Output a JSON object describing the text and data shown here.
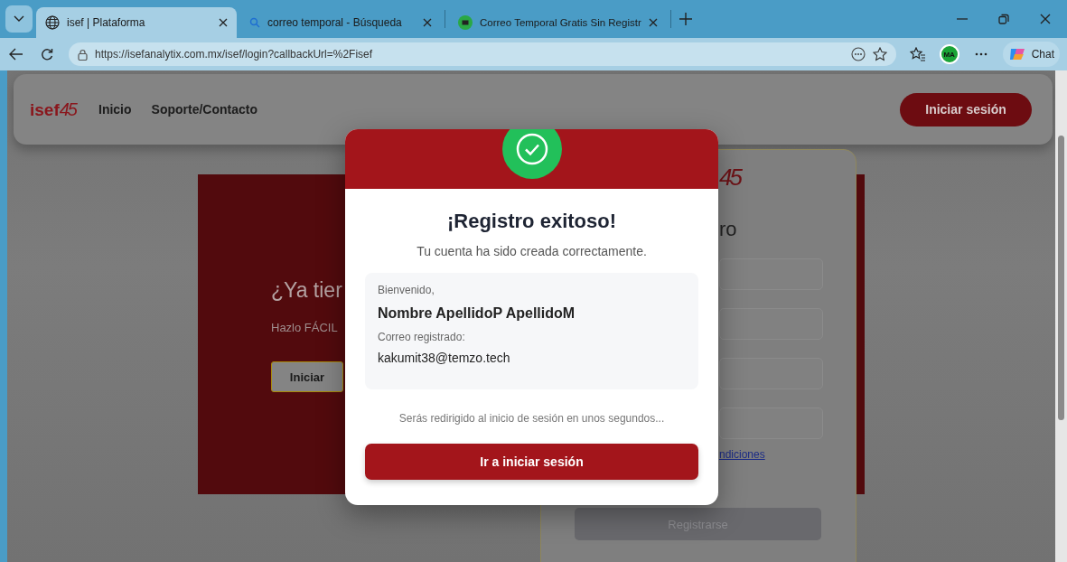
{
  "browser": {
    "tabs": [
      {
        "title": "isef | Plataforma",
        "selected": true
      },
      {
        "title": "correo temporal - Búsqueda",
        "selected": false
      },
      {
        "title": "Correo Temporal Gratis Sin Registr",
        "selected": false
      }
    ],
    "address": "https://isefanalytix.com.mx/isef/login?callbackUrl=%2Fisef",
    "profile": "MA",
    "chat": "Chat"
  },
  "header": {
    "logo": "isef",
    "logo_mark": "45",
    "nav": [
      "Inicio",
      "Soporte/Contacto"
    ],
    "login_button": "Iniciar sesión"
  },
  "left_panel": {
    "heading": "¿Ya tier",
    "text": "Hazlo FÁCIL",
    "button": "Iniciar"
  },
  "form": {
    "logo_mark": "45",
    "title": "ro",
    "link": "ndiciones",
    "submit": {
      "label": "Registrarse",
      "disabled": true
    }
  },
  "modal": {
    "title": "¡Registro exitoso!",
    "subtitle": "Tu cuenta ha sido creada correctamente.",
    "welcome_label": "Bienvenido,",
    "name": "Nombre ApellidoP ApellidoM",
    "email_label": "Correo registrado:",
    "email": "kakumit38@temzo.tech",
    "redirect_note": "Serás redirigido al inicio de sesión en unos segundos...",
    "button": "Ir a iniciar sesión"
  }
}
